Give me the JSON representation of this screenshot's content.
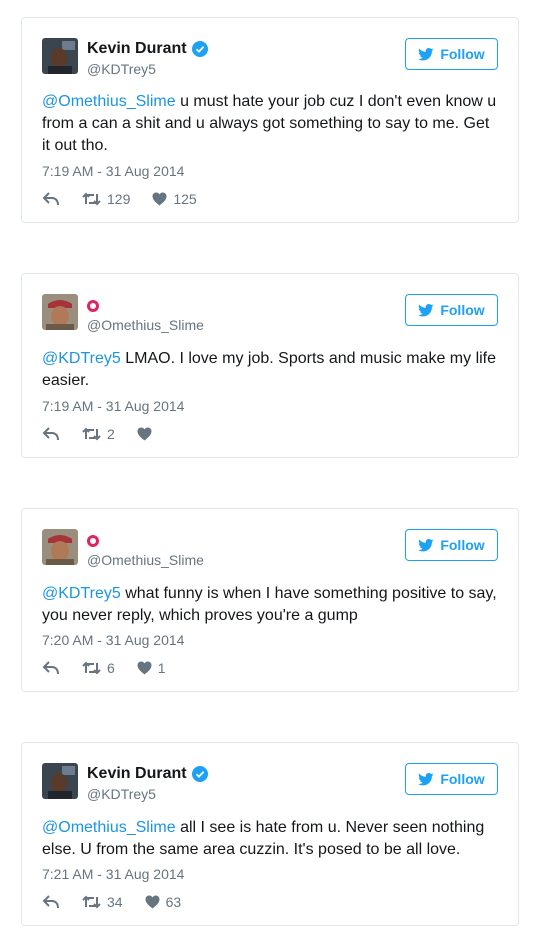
{
  "colors": {
    "link": "#1b95e0",
    "follow": "#1da1f2",
    "muted": "#66757f",
    "verified": "#1da1f2",
    "ring": "#e0245e"
  },
  "follow_label": "Follow",
  "tweets": [
    {
      "display_name": "Kevin Durant",
      "handle": "@KDTrey5",
      "verified": true,
      "mention": "@Omethius_Slime",
      "body": " u must hate your job cuz I don't even know u from a can a shit and u always got something to say to me. Get it out tho.",
      "time": "7:19 AM - 31 Aug 2014",
      "retweets": "129",
      "likes": "125"
    },
    {
      "display_name": "",
      "handle": "@Omethius_Slime",
      "verified": false,
      "mention": "@KDTrey5",
      "body": " LMAO. I love my job. Sports and music make my life easier.",
      "time": "7:19 AM - 31 Aug 2014",
      "retweets": "2",
      "likes": ""
    },
    {
      "display_name": "",
      "handle": "@Omethius_Slime",
      "verified": false,
      "mention": "@KDTrey5",
      "body": " what funny is when I have something positive to say, you never reply, which proves you're a gump",
      "time": "7:20 AM - 31 Aug 2014",
      "retweets": "6",
      "likes": "1"
    },
    {
      "display_name": "Kevin Durant",
      "handle": "@KDTrey5",
      "verified": true,
      "mention": "@Omethius_Slime",
      "body": " all I see is hate from u. Never seen nothing else. U from the same area cuzzin. It's posed to be all love.",
      "time": "7:21 AM - 31 Aug 2014",
      "retweets": "34",
      "likes": "63"
    }
  ]
}
